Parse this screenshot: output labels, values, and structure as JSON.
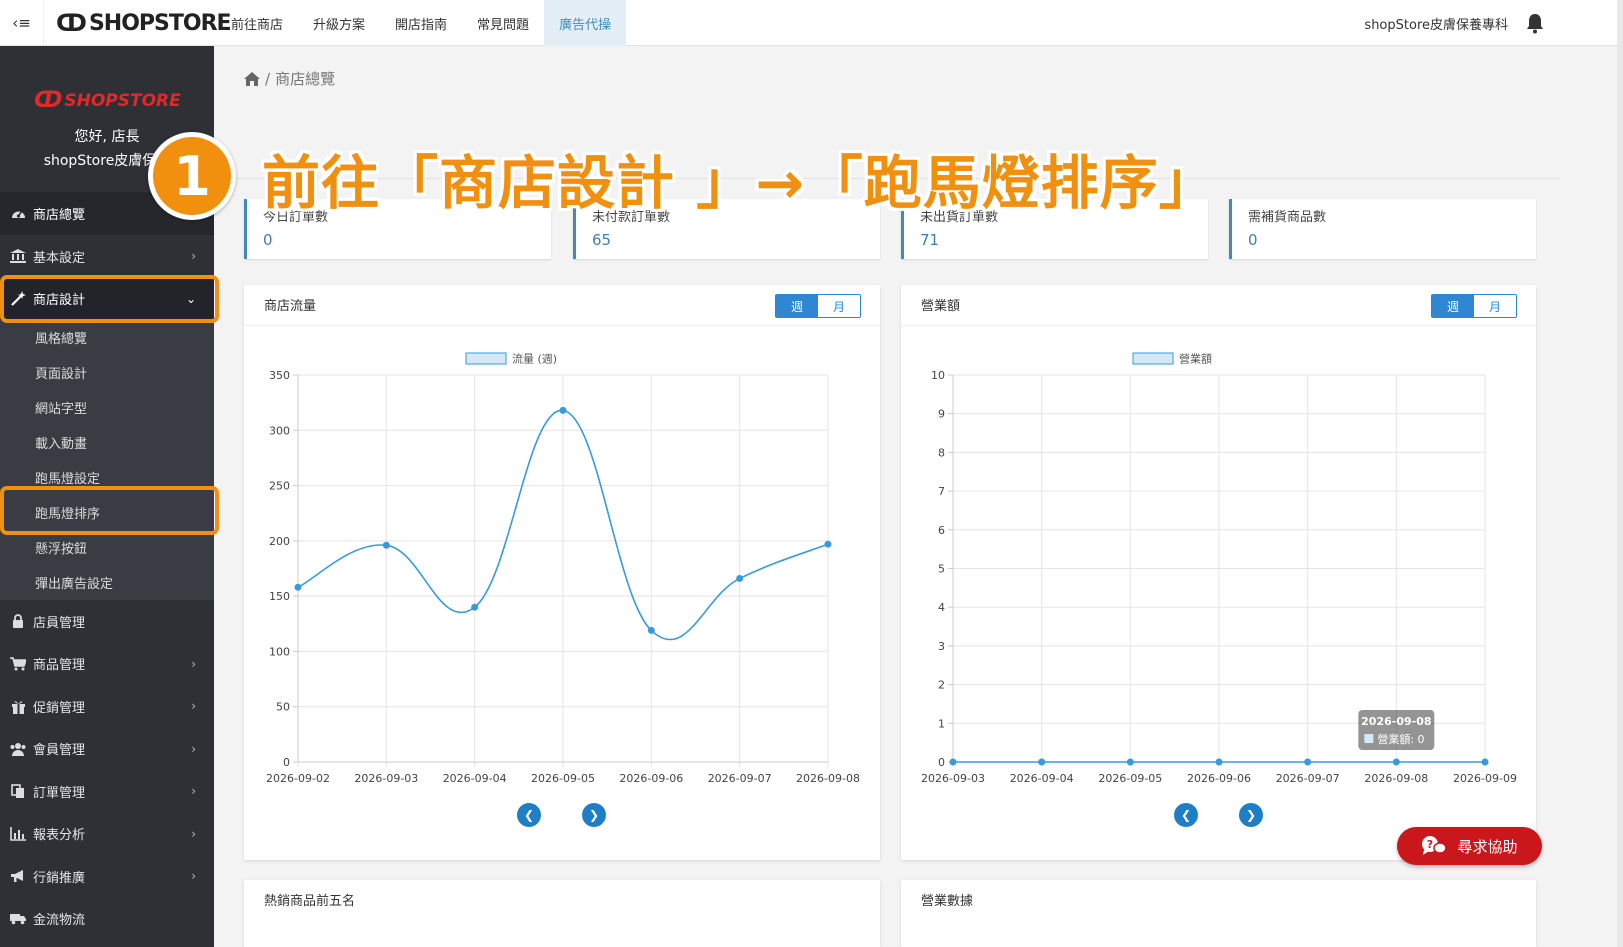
{
  "topbar": {
    "toggle_icon": "‹≡",
    "brand": "SHOPSTORE",
    "nav": [
      "前往商店",
      "升級方案",
      "開店指南",
      "常見問題",
      "廣告代操"
    ],
    "active_nav_index": 4,
    "shop_name": "shopStore皮膚保養專科"
  },
  "sidebar": {
    "logo": "SHOPSTORE",
    "greeting_1": "您好, 店長",
    "greeting_2": "shopStore皮膚保養",
    "menu": [
      {
        "label": "商店總覽",
        "icon": "dashboard-icon"
      },
      {
        "label": "基本設定",
        "icon": "bank-icon"
      },
      {
        "label": "商店設計",
        "icon": "magic-wand-icon"
      },
      {
        "label": "店員管理",
        "icon": "lock-icon"
      },
      {
        "label": "商品管理",
        "icon": "cart-icon"
      },
      {
        "label": "促銷管理",
        "icon": "gift-icon"
      },
      {
        "label": "會員管理",
        "icon": "users-icon"
      },
      {
        "label": "訂單管理",
        "icon": "copy-icon"
      },
      {
        "label": "報表分析",
        "icon": "bar-chart-icon"
      },
      {
        "label": "行銷推廣",
        "icon": "bullhorn-icon"
      },
      {
        "label": "金流物流",
        "icon": "truck-icon"
      }
    ],
    "submenu": [
      "風格總覽",
      "頁面設計",
      "網站字型",
      "載入動畫",
      "跑馬燈設定",
      "跑馬燈排序",
      "懸浮按鈕",
      "彈出廣告設定"
    ]
  },
  "breadcrumb": {
    "current": "商店總覽"
  },
  "annotation": {
    "step": "1",
    "text": "前往「商店設計 」→「跑馬燈排序」",
    "color": "#f0900e"
  },
  "stats": [
    {
      "label": "今日訂單數",
      "value": "0"
    },
    {
      "label": "未付款訂單數",
      "value": "65"
    },
    {
      "label": "未出貨訂單數",
      "value": "71"
    },
    {
      "label": "需補貨商品數",
      "value": "0"
    }
  ],
  "panels": {
    "traffic": {
      "title": "商店流量",
      "week": "週",
      "month": "月"
    },
    "revenue": {
      "title": "營業額",
      "week": "週",
      "month": "月"
    },
    "top_products": {
      "title": "熱銷商品前五名"
    },
    "business_data": {
      "title": "營業數據"
    }
  },
  "help_button": "尋求協助",
  "chart_data": [
    {
      "type": "line",
      "legend": "流量 (週)",
      "x": [
        "2026-09-02",
        "2026-09-03",
        "2026-09-04",
        "2026-09-05",
        "2026-09-06",
        "2026-09-07",
        "2026-09-08"
      ],
      "series": [
        {
          "name": "流量 (週)",
          "values": [
            158,
            196,
            140,
            318,
            119,
            166,
            197
          ]
        }
      ],
      "ylim": [
        0,
        350
      ],
      "yticks": [
        0,
        50,
        100,
        150,
        200,
        250,
        300,
        350
      ],
      "smooth": true,
      "grid": true,
      "color": "#3a9ad9"
    },
    {
      "type": "line",
      "legend": "營業額",
      "x": [
        "2026-09-03",
        "2026-09-04",
        "2026-09-05",
        "2026-09-06",
        "2026-09-07",
        "2026-09-08",
        "2026-09-09"
      ],
      "series": [
        {
          "name": "營業額",
          "values": [
            0,
            0,
            0,
            0,
            0,
            0,
            0
          ]
        }
      ],
      "ylim": [
        0,
        10
      ],
      "yticks": [
        0,
        1,
        2,
        3,
        4,
        5,
        6,
        7,
        8,
        9,
        10
      ],
      "grid": true,
      "color": "#3a9ad9",
      "tooltip": {
        "title": "2026-09-08",
        "label": "營業額: 0"
      }
    }
  ]
}
